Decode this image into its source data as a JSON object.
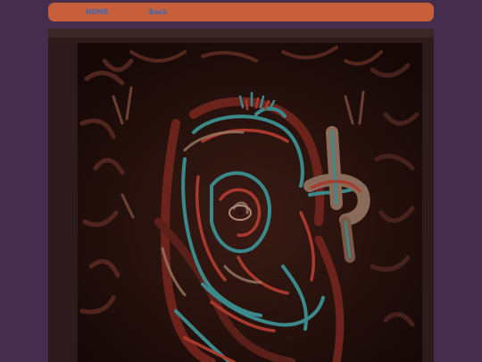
{
  "nav": {
    "home_label": "HOME",
    "back_label": "Back"
  },
  "colors": {
    "page_background": "#452e4d",
    "nav_background": "#c65f3a",
    "nav_link": "#3e67b5",
    "frame_background": "#2d1a1d"
  },
  "content": {
    "artwork_icon": "abstract-painting-image"
  }
}
